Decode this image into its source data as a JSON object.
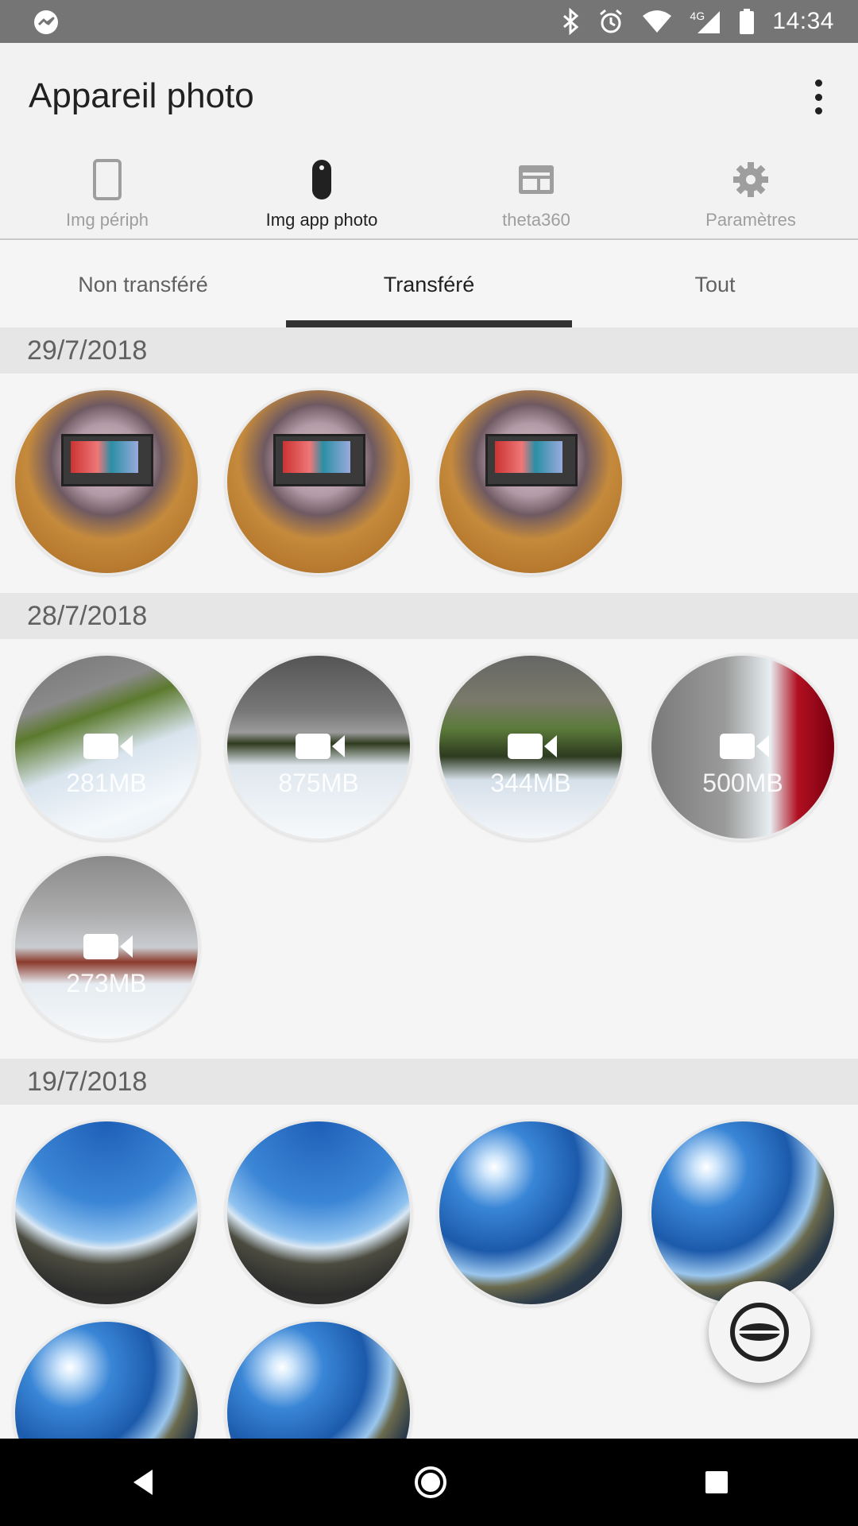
{
  "status_bar": {
    "time": "14:34",
    "network_label": "4G",
    "icons": [
      "messenger-icon",
      "bluetooth-icon",
      "alarm-icon",
      "wifi-icon",
      "signal-icon",
      "battery-icon"
    ]
  },
  "app_bar": {
    "title": "Appareil photo"
  },
  "top_nav": {
    "items": [
      {
        "label": "Img périph",
        "icon": "phone-icon"
      },
      {
        "label": "Img app photo",
        "icon": "camera-device-icon"
      },
      {
        "label": "theta360",
        "icon": "theta360-icon"
      },
      {
        "label": "Paramètres",
        "icon": "gear-icon"
      }
    ],
    "active_index": 1
  },
  "tabs": {
    "items": [
      "Non transféré",
      "Transféré",
      "Tout"
    ],
    "active_index": 1
  },
  "sections": [
    {
      "date": "29/7/2018",
      "items": [
        {
          "type": "photo"
        },
        {
          "type": "photo"
        },
        {
          "type": "photo"
        }
      ]
    },
    {
      "date": "28/7/2018",
      "items": [
        {
          "type": "video",
          "size": "281MB"
        },
        {
          "type": "video",
          "size": "875MB"
        },
        {
          "type": "video",
          "size": "344MB"
        },
        {
          "type": "video",
          "size": "500MB"
        },
        {
          "type": "video",
          "size": "273MB"
        }
      ]
    },
    {
      "date": "19/7/2018",
      "items": [
        {
          "type": "photo"
        },
        {
          "type": "photo"
        },
        {
          "type": "photo"
        },
        {
          "type": "photo"
        },
        {
          "type": "photo"
        },
        {
          "type": "photo"
        }
      ]
    }
  ],
  "fab": {
    "icon": "theta-capture-icon"
  },
  "nav_bar": {
    "icons": [
      "back-icon",
      "home-icon",
      "recents-icon"
    ]
  }
}
